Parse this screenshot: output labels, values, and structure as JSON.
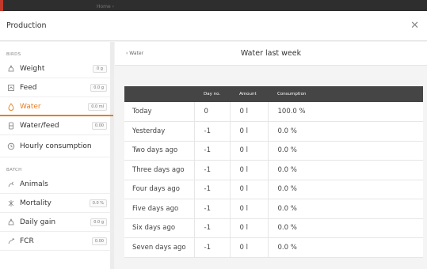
{
  "backdrop": {
    "faint_text": "Home ›"
  },
  "modal": {
    "title": "Production",
    "close_icon": "close-icon"
  },
  "sidebar": {
    "birds_label": "BIRDS",
    "birds_items": [
      {
        "label": "Weight",
        "badge": "0 g",
        "icon": "weight-icon",
        "active": false
      },
      {
        "label": "Feed",
        "badge": "0.0 g",
        "icon": "feed-icon",
        "active": false
      },
      {
        "label": "Water",
        "badge": "0.0 ml",
        "icon": "water-drop-icon",
        "active": true
      },
      {
        "label": "Water/feed",
        "badge": "0.00",
        "icon": "water-feed-icon",
        "active": false
      },
      {
        "label": "Hourly consumption",
        "badge": "",
        "icon": "clock-icon",
        "active": false
      }
    ],
    "batch_label": "BATCH",
    "batch_items": [
      {
        "label": "Animals",
        "badge": "",
        "icon": "animals-icon"
      },
      {
        "label": "Mortality",
        "badge": "0.0 %",
        "icon": "mortality-icon"
      },
      {
        "label": "Daily gain",
        "badge": "0.0 g",
        "icon": "daily-gain-icon"
      },
      {
        "label": "FCR",
        "badge": "0.00",
        "icon": "fcr-icon"
      }
    ]
  },
  "main": {
    "back_label": "‹ Water",
    "title": "Water last week",
    "columns": [
      "",
      "Day no.",
      "Amount",
      "Consumption"
    ],
    "rows": [
      [
        "Today",
        "0",
        "0 l",
        "100.0 %"
      ],
      [
        "Yesterday",
        "-1",
        "0 l",
        "0.0 %"
      ],
      [
        "Two days ago",
        "-1",
        "0 l",
        "0.0 %"
      ],
      [
        "Three days ago",
        "-1",
        "0 l",
        "0.0 %"
      ],
      [
        "Four days ago",
        "-1",
        "0 l",
        "0.0 %"
      ],
      [
        "Five days ago",
        "-1",
        "0 l",
        "0.0 %"
      ],
      [
        "Six days ago",
        "-1",
        "0 l",
        "0.0 %"
      ],
      [
        "Seven days ago",
        "-1",
        "0 l",
        "0.0 %"
      ]
    ]
  },
  "colors": {
    "accent": "#e67e22",
    "table_header": "#454545"
  }
}
